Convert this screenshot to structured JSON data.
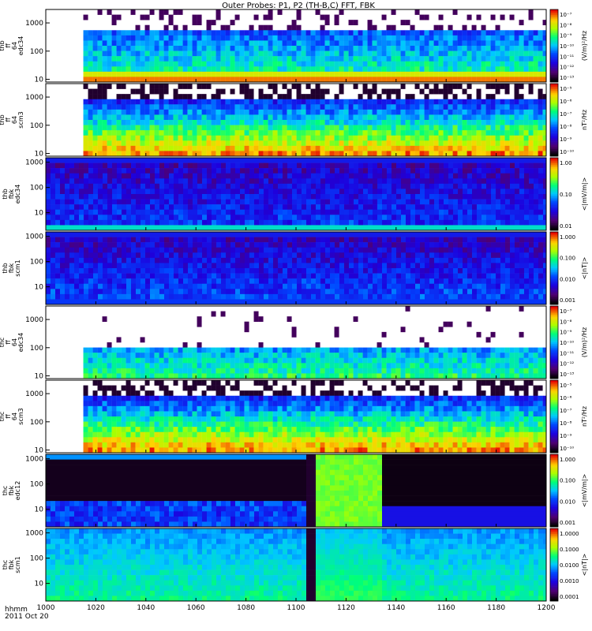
{
  "title": "Outer Probes: P1, P2 (TH-B,C) FFT, FBK",
  "time_axis": {
    "ticks": [
      "1000",
      "1020",
      "1040",
      "1060",
      "1080",
      "1100",
      "1120",
      "1140",
      "1160",
      "1180",
      "1200"
    ],
    "label_line1": "hhmm",
    "label_line2": "2011 Oct 20"
  },
  "chart_data": [
    {
      "type": "heatmap",
      "panel_labels": [
        "thb",
        "ff",
        "64",
        "edc34"
      ],
      "y_ticks": [
        "10",
        "100",
        "1000"
      ],
      "y_log": true,
      "y_range": [
        8,
        3000
      ],
      "colorbar_ticks": [
        "10⁻¹³",
        "10⁻¹²",
        "10⁻¹¹",
        "10⁻¹⁰",
        "10⁻⁹",
        "10⁻⁸",
        "10⁻⁷"
      ],
      "colorbar_label": "(V/m)²/Hz",
      "data_start": 1015,
      "style": "spiky",
      "level": 0.28
    },
    {
      "type": "heatmap",
      "panel_labels": [
        "thb",
        "ff",
        "64",
        "scm3"
      ],
      "y_ticks": [
        "10",
        "100",
        "1000"
      ],
      "y_log": true,
      "y_range": [
        8,
        3000
      ],
      "colorbar_ticks": [
        "10⁻¹⁰",
        "10⁻⁹",
        "10⁻⁸",
        "10⁻⁷",
        "10⁻⁶",
        "10⁻⁵"
      ],
      "colorbar_label": "nT²/Hz",
      "data_start": 1015,
      "style": "gradient",
      "level": 0.4
    },
    {
      "type": "heatmap",
      "panel_labels": [
        "thb",
        "fbk",
        "edc34"
      ],
      "y_ticks": [
        "10",
        "100",
        "1000"
      ],
      "y_log": true,
      "y_range": [
        2,
        1500
      ],
      "colorbar_ticks": [
        "0.01",
        "0.10",
        "1.00"
      ],
      "colorbar_label": "<|mV/m|>",
      "data_start": 1000,
      "style": "fbk_e",
      "level": 0.2
    },
    {
      "type": "heatmap",
      "panel_labels": [
        "thb",
        "fbk",
        "scm1"
      ],
      "y_ticks": [
        "10",
        "100",
        "1000"
      ],
      "y_log": true,
      "y_range": [
        2,
        1500
      ],
      "colorbar_ticks": [
        "0.001",
        "0.010",
        "0.100",
        "1.000"
      ],
      "colorbar_label": "<|nT|>",
      "data_start": 1000,
      "style": "fbk_b",
      "level": 0.2
    },
    {
      "type": "heatmap",
      "panel_labels": [
        "thc",
        "ff",
        "64",
        "edc34"
      ],
      "y_ticks": [
        "10",
        "100",
        "1000"
      ],
      "y_log": true,
      "y_range": [
        8,
        3000
      ],
      "colorbar_ticks": [
        "10⁻¹³",
        "10⁻¹²",
        "10⁻¹¹",
        "10⁻¹⁰",
        "10⁻⁹",
        "10⁻⁸",
        "10⁻⁷"
      ],
      "colorbar_label": "(V/m)²/Hz",
      "data_start": 1015,
      "style": "low",
      "level": 0.22
    },
    {
      "type": "heatmap",
      "panel_labels": [
        "thc",
        "ff",
        "64",
        "scm3"
      ],
      "y_ticks": [
        "10",
        "100",
        "1000"
      ],
      "y_log": true,
      "y_range": [
        8,
        3000
      ],
      "colorbar_ticks": [
        "10⁻¹⁰",
        "10⁻⁹",
        "10⁻⁸",
        "10⁻⁷",
        "10⁻⁶",
        "10⁻⁵"
      ],
      "colorbar_label": "nT²/Hz",
      "data_start": 1015,
      "style": "gradient",
      "level": 0.45
    },
    {
      "type": "heatmap",
      "panel_labels": [
        "thc",
        "fbk",
        "edc12"
      ],
      "y_ticks": [
        "10",
        "100",
        "1000"
      ],
      "y_log": true,
      "y_range": [
        2,
        1500
      ],
      "colorbar_ticks": [
        "0.001",
        "0.010",
        "0.100",
        "1.000"
      ],
      "colorbar_label": "<|mV/m|>",
      "data_start": 1000,
      "style": "fbk_thc_e",
      "level": 0.25
    },
    {
      "type": "heatmap",
      "panel_labels": [
        "thc",
        "fbk",
        "scm1"
      ],
      "y_ticks": [
        "10",
        "100",
        "1000"
      ],
      "y_log": true,
      "y_range": [
        2,
        1500
      ],
      "colorbar_ticks": [
        "0.0001",
        "0.0010",
        "0.0100",
        "0.1000",
        "1.0000"
      ],
      "colorbar_label": "<|nT|>",
      "data_start": 1000,
      "style": "fbk_thc_b",
      "level": 0.45
    }
  ]
}
